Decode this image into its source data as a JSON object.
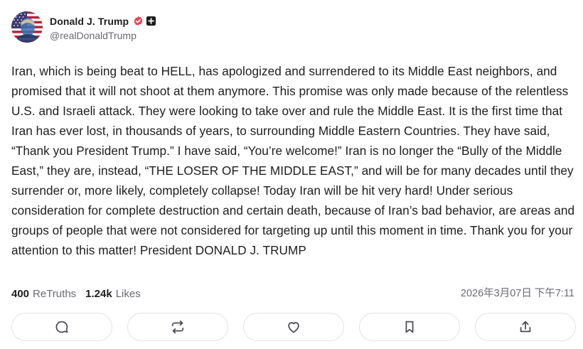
{
  "author": {
    "display_name": "Donald J. Trump",
    "handle": "@realDonaldTrump",
    "verified_badge_color": "#e8455a",
    "avatar_icon": "flag-portrait-avatar"
  },
  "post": {
    "text": "Iran, which is being beat to HELL, has apologized and surrendered to its Middle East neighbors, and promised that it will not shoot at them anymore. This promise was only made because of the relentless U.S. and Israeli attack. They were looking to take over and rule the Middle East. It is the first time that Iran has ever lost, in thousands of years, to surrounding Middle Eastern Countries. They have said, “Thank you President Trump.” I have said, “You’re welcome!” Iran is no longer the “Bully of the Middle East,” they are, instead, “THE LOSER OF THE MIDDLE EAST,” and will be for many decades until they surrender or, more likely, completely collapse! Today Iran will be hit very hard! Under serious consideration for complete destruction and certain death, because of Iran’s bad behavior, are areas and groups of people that were not considered for targeting up until this moment in time. Thank you for your attention to this matter! President DONALD J. TRUMP"
  },
  "stats": {
    "retruths_count": "400",
    "retruths_label": "ReTruths",
    "likes_count": "1.24k",
    "likes_label": "Likes"
  },
  "timestamp": "2026年3月07日 下午7:11",
  "actions": [
    {
      "name": "reply",
      "icon": "speech-bubble-icon"
    },
    {
      "name": "retruth",
      "icon": "repost-arrows-icon"
    },
    {
      "name": "like",
      "icon": "heart-icon"
    },
    {
      "name": "bookmark",
      "icon": "bookmark-icon"
    },
    {
      "name": "share",
      "icon": "share-icon"
    }
  ]
}
